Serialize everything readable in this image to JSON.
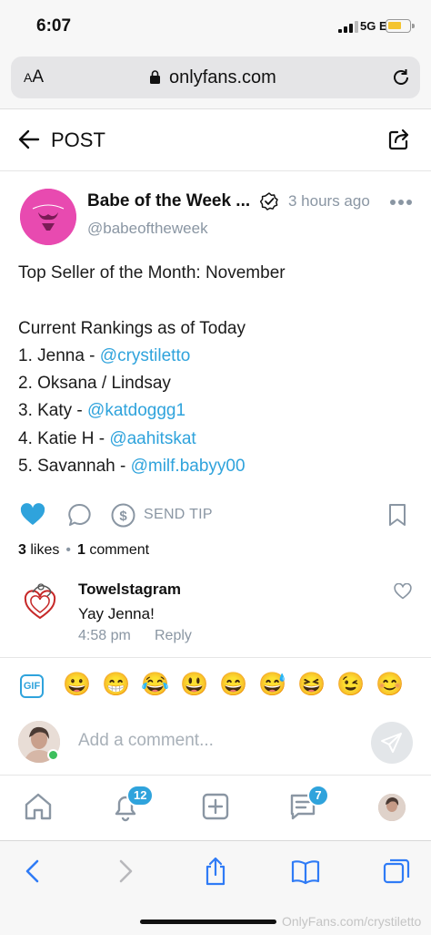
{
  "status_bar": {
    "time": "6:07",
    "network": "5G E"
  },
  "browser": {
    "text_size_label_small": "A",
    "text_size_label_large": "A",
    "domain": "onlyfans.com"
  },
  "header": {
    "title": "POST"
  },
  "post": {
    "author_name": "Babe of the Week ...",
    "handle": "@babeoftheweek",
    "time": "3 hours ago",
    "lines": [
      {
        "text": "Top Seller of the Month: November",
        "mention": ""
      },
      {
        "text": "",
        "mention": ""
      },
      {
        "text": "Current Rankings as of Today",
        "mention": ""
      },
      {
        "text": "1. Jenna - ",
        "mention": "@crystiletto"
      },
      {
        "text": "2. Oksana / Lindsay",
        "mention": ""
      },
      {
        "text": "3. Katy - ",
        "mention": "@katdoggg1"
      },
      {
        "text": "4. Katie H - ",
        "mention": "@aahitskat"
      },
      {
        "text": "5. Savannah - ",
        "mention": "@milf.babyy00"
      }
    ]
  },
  "actions": {
    "send_tip_label": "SEND TIP",
    "liked": true
  },
  "counts": {
    "likes_number": "3",
    "likes_label": " likes",
    "separator": "•",
    "comments_number": "1",
    "comments_label": " comment"
  },
  "comment": {
    "user": "Towelstagram",
    "text": "Yay Jenna!",
    "time": "4:58 pm",
    "reply_label": "Reply"
  },
  "emoji_bar": {
    "gif_label": "GIF",
    "emojis": [
      "😀",
      "😁",
      "😂",
      "😃",
      "😄",
      "😅",
      "😆",
      "😉",
      "😊"
    ]
  },
  "comment_input": {
    "placeholder": "Add a comment..."
  },
  "bottom_nav": {
    "notifications_badge": "12",
    "messages_badge": "7"
  },
  "footer": {
    "watermark": "OnlyFans.com/crystiletto"
  },
  "colors": {
    "accent": "#2fa3dc",
    "muted": "#8a96a3",
    "online": "#3dbf5d",
    "avatar_pink": "#e84ab0"
  }
}
